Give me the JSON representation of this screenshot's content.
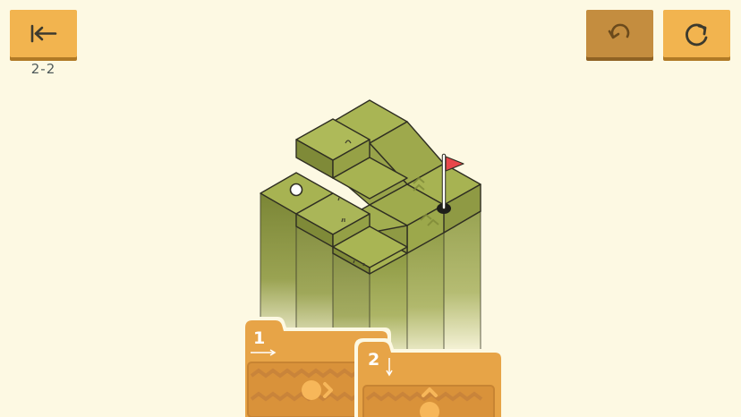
{
  "level": {
    "label": "2-2"
  },
  "toolbar": {
    "back_icon": "arrow-bar-left-icon",
    "undo_icon": "undo-arrow-icon",
    "restart_icon": "restart-icon"
  },
  "colors": {
    "background": "#fdf9e3",
    "button": "#f2b44f",
    "button_disabled": "#c48d3f",
    "grass_top": "#a7b352",
    "grass_dark": "#848f3b",
    "card": "#e7a447",
    "flag": "#e8474a"
  },
  "cards": [
    {
      "number": "1",
      "move": "forward-roll-icon"
    },
    {
      "number": "2",
      "move": "up-roll-icon"
    }
  ]
}
